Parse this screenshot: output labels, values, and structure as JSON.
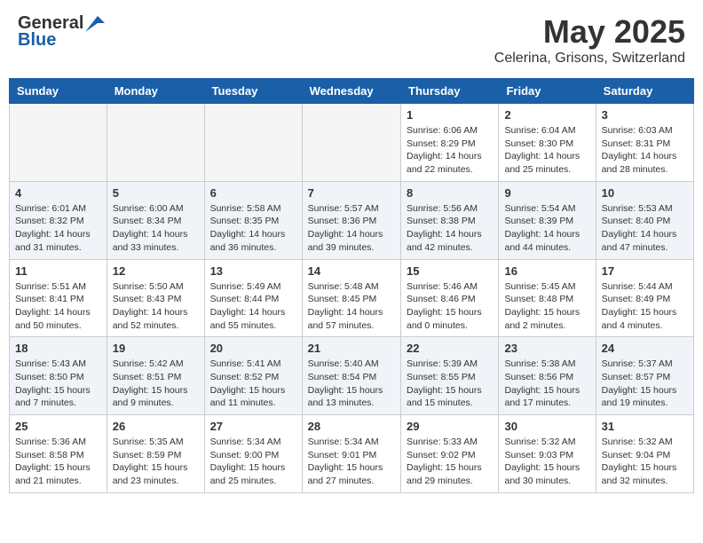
{
  "header": {
    "logo_general": "General",
    "logo_blue": "Blue",
    "month_title": "May 2025",
    "subtitle": "Celerina, Grisons, Switzerland"
  },
  "weekdays": [
    "Sunday",
    "Monday",
    "Tuesday",
    "Wednesday",
    "Thursday",
    "Friday",
    "Saturday"
  ],
  "weeks": [
    [
      {
        "day": "",
        "empty": true
      },
      {
        "day": "",
        "empty": true
      },
      {
        "day": "",
        "empty": true
      },
      {
        "day": "",
        "empty": true
      },
      {
        "day": "1",
        "sunrise": "6:06 AM",
        "sunset": "8:29 PM",
        "daylight": "14 hours and 22 minutes."
      },
      {
        "day": "2",
        "sunrise": "6:04 AM",
        "sunset": "8:30 PM",
        "daylight": "14 hours and 25 minutes."
      },
      {
        "day": "3",
        "sunrise": "6:03 AM",
        "sunset": "8:31 PM",
        "daylight": "14 hours and 28 minutes."
      }
    ],
    [
      {
        "day": "4",
        "sunrise": "6:01 AM",
        "sunset": "8:32 PM",
        "daylight": "14 hours and 31 minutes."
      },
      {
        "day": "5",
        "sunrise": "6:00 AM",
        "sunset": "8:34 PM",
        "daylight": "14 hours and 33 minutes."
      },
      {
        "day": "6",
        "sunrise": "5:58 AM",
        "sunset": "8:35 PM",
        "daylight": "14 hours and 36 minutes."
      },
      {
        "day": "7",
        "sunrise": "5:57 AM",
        "sunset": "8:36 PM",
        "daylight": "14 hours and 39 minutes."
      },
      {
        "day": "8",
        "sunrise": "5:56 AM",
        "sunset": "8:38 PM",
        "daylight": "14 hours and 42 minutes."
      },
      {
        "day": "9",
        "sunrise": "5:54 AM",
        "sunset": "8:39 PM",
        "daylight": "14 hours and 44 minutes."
      },
      {
        "day": "10",
        "sunrise": "5:53 AM",
        "sunset": "8:40 PM",
        "daylight": "14 hours and 47 minutes."
      }
    ],
    [
      {
        "day": "11",
        "sunrise": "5:51 AM",
        "sunset": "8:41 PM",
        "daylight": "14 hours and 50 minutes."
      },
      {
        "day": "12",
        "sunrise": "5:50 AM",
        "sunset": "8:43 PM",
        "daylight": "14 hours and 52 minutes."
      },
      {
        "day": "13",
        "sunrise": "5:49 AM",
        "sunset": "8:44 PM",
        "daylight": "14 hours and 55 minutes."
      },
      {
        "day": "14",
        "sunrise": "5:48 AM",
        "sunset": "8:45 PM",
        "daylight": "14 hours and 57 minutes."
      },
      {
        "day": "15",
        "sunrise": "5:46 AM",
        "sunset": "8:46 PM",
        "daylight": "15 hours and 0 minutes."
      },
      {
        "day": "16",
        "sunrise": "5:45 AM",
        "sunset": "8:48 PM",
        "daylight": "15 hours and 2 minutes."
      },
      {
        "day": "17",
        "sunrise": "5:44 AM",
        "sunset": "8:49 PM",
        "daylight": "15 hours and 4 minutes."
      }
    ],
    [
      {
        "day": "18",
        "sunrise": "5:43 AM",
        "sunset": "8:50 PM",
        "daylight": "15 hours and 7 minutes."
      },
      {
        "day": "19",
        "sunrise": "5:42 AM",
        "sunset": "8:51 PM",
        "daylight": "15 hours and 9 minutes."
      },
      {
        "day": "20",
        "sunrise": "5:41 AM",
        "sunset": "8:52 PM",
        "daylight": "15 hours and 11 minutes."
      },
      {
        "day": "21",
        "sunrise": "5:40 AM",
        "sunset": "8:54 PM",
        "daylight": "15 hours and 13 minutes."
      },
      {
        "day": "22",
        "sunrise": "5:39 AM",
        "sunset": "8:55 PM",
        "daylight": "15 hours and 15 minutes."
      },
      {
        "day": "23",
        "sunrise": "5:38 AM",
        "sunset": "8:56 PM",
        "daylight": "15 hours and 17 minutes."
      },
      {
        "day": "24",
        "sunrise": "5:37 AM",
        "sunset": "8:57 PM",
        "daylight": "15 hours and 19 minutes."
      }
    ],
    [
      {
        "day": "25",
        "sunrise": "5:36 AM",
        "sunset": "8:58 PM",
        "daylight": "15 hours and 21 minutes."
      },
      {
        "day": "26",
        "sunrise": "5:35 AM",
        "sunset": "8:59 PM",
        "daylight": "15 hours and 23 minutes."
      },
      {
        "day": "27",
        "sunrise": "5:34 AM",
        "sunset": "9:00 PM",
        "daylight": "15 hours and 25 minutes."
      },
      {
        "day": "28",
        "sunrise": "5:34 AM",
        "sunset": "9:01 PM",
        "daylight": "15 hours and 27 minutes."
      },
      {
        "day": "29",
        "sunrise": "5:33 AM",
        "sunset": "9:02 PM",
        "daylight": "15 hours and 29 minutes."
      },
      {
        "day": "30",
        "sunrise": "5:32 AM",
        "sunset": "9:03 PM",
        "daylight": "15 hours and 30 minutes."
      },
      {
        "day": "31",
        "sunrise": "5:32 AM",
        "sunset": "9:04 PM",
        "daylight": "15 hours and 32 minutes."
      }
    ]
  ]
}
